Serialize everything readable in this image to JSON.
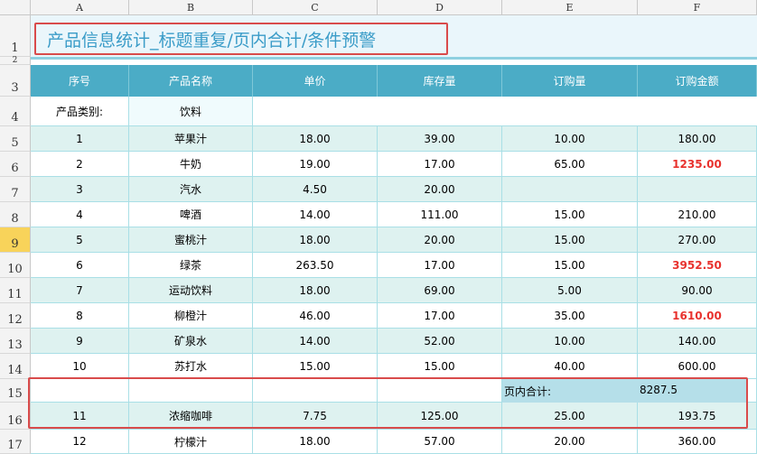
{
  "columns": [
    "A",
    "B",
    "C",
    "D",
    "E",
    "F"
  ],
  "row_numbers": [
    "1",
    "2",
    "3",
    "4",
    "5",
    "6",
    "7",
    "8",
    "9",
    "10",
    "11",
    "12",
    "13",
    "14",
    "15",
    "16",
    "17"
  ],
  "title": "产品信息统计_标题重复/页内合计/条件预警",
  "headers": [
    "序号",
    "产品名称",
    "单价",
    "库存量",
    "订购量",
    "订购金额"
  ],
  "category": {
    "label": "产品类别:",
    "value": "饮料"
  },
  "rows": [
    {
      "no": "1",
      "name": "苹果汁",
      "price": "18.00",
      "stock": "39.00",
      "qty": "10.00",
      "amount": "180.00",
      "alert": false
    },
    {
      "no": "2",
      "name": "牛奶",
      "price": "19.00",
      "stock": "17.00",
      "qty": "65.00",
      "amount": "1235.00",
      "alert": true
    },
    {
      "no": "3",
      "name": "汽水",
      "price": "4.50",
      "stock": "20.00",
      "qty": "",
      "amount": "",
      "alert": false
    },
    {
      "no": "4",
      "name": "啤酒",
      "price": "14.00",
      "stock": "111.00",
      "qty": "15.00",
      "amount": "210.00",
      "alert": false
    },
    {
      "no": "5",
      "name": "蜜桃汁",
      "price": "18.00",
      "stock": "20.00",
      "qty": "15.00",
      "amount": "270.00",
      "alert": false
    },
    {
      "no": "6",
      "name": "绿茶",
      "price": "263.50",
      "stock": "17.00",
      "qty": "15.00",
      "amount": "3952.50",
      "alert": true
    },
    {
      "no": "7",
      "name": "运动饮料",
      "price": "18.00",
      "stock": "69.00",
      "qty": "5.00",
      "amount": "90.00",
      "alert": false
    },
    {
      "no": "8",
      "name": "柳橙汁",
      "price": "46.00",
      "stock": "17.00",
      "qty": "35.00",
      "amount": "1610.00",
      "alert": true
    },
    {
      "no": "9",
      "name": "矿泉水",
      "price": "14.00",
      "stock": "52.00",
      "qty": "10.00",
      "amount": "140.00",
      "alert": false
    },
    {
      "no": "10",
      "name": "苏打水",
      "price": "15.00",
      "stock": "15.00",
      "qty": "40.00",
      "amount": "600.00",
      "alert": false
    }
  ],
  "page_total": {
    "label": "页内合计:",
    "value": "8287.5"
  },
  "rows_after": [
    {
      "no": "11",
      "name": "浓缩咖啡",
      "price": "7.75",
      "stock": "125.00",
      "qty": "25.00",
      "amount": "193.75",
      "alert": false
    },
    {
      "no": "12",
      "name": "柠檬汁",
      "price": "18.00",
      "stock": "57.00",
      "qty": "20.00",
      "amount": "360.00",
      "alert": false
    }
  ],
  "selected_row": "9",
  "colors": {
    "header_bg": "#4bacc6",
    "band": "#def2f0",
    "alert": "#e8322e",
    "title": "#3a9cc8",
    "frame": "#d94b4b"
  }
}
